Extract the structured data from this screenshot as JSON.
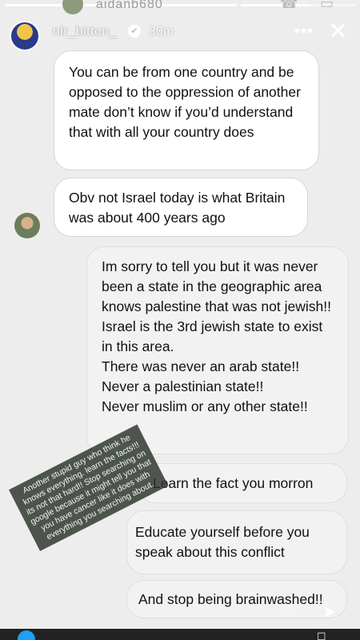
{
  "story": {
    "progress_segments": [
      1,
      1,
      0.6
    ],
    "previous_item": {
      "username": "aidanb680"
    },
    "header": {
      "username": "nir_bitton_",
      "time": "30m",
      "more_label": "•••",
      "close_label": "✕"
    }
  },
  "messages": {
    "b1": "You can be from one country and be opposed to the oppression of another mate don’t know if you’d understand that with all your country does",
    "b2": "Obv not Israel today is what Britain was about 400 years ago",
    "b3": [
      "Im sorry to tell you but it was never been a state in the geographic area knows palestine that was not jewish!!",
      "Israel is the 3rd jewish state to exist in this area.",
      "There was never an arab state!!",
      "Never a palestinian state!!",
      "Never muslim or any other state!!"
    ],
    "b4": "Learn the fact you morron",
    "b5": "Educate yourself before you speak about this conflict",
    "b6": "And stop being brainwashed!!"
  },
  "sticker_text": "Another stupid guy who think he knows everything. learn the facts!!! its not that hard!! Stop searching on google because it might tell you that you have cancer like it does with everything you searching about.",
  "icons": {
    "heart": "heart-icon",
    "send": "send-icon",
    "close": "close-icon"
  },
  "colors": {
    "background": "#ededed",
    "bubble_left": "#ffffff",
    "bubble_right": "#f2f2f2",
    "sticker_bg": "#283228"
  }
}
